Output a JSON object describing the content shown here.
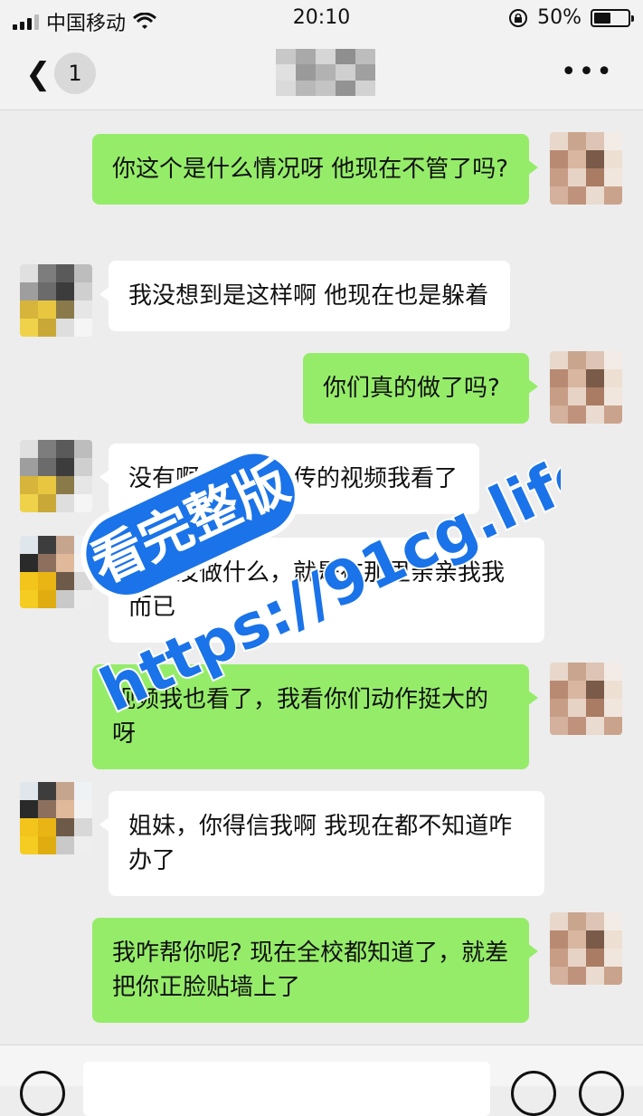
{
  "status_bar": {
    "carrier": "中国移动",
    "time": "20:10",
    "battery": "50%",
    "battery_level": 0.5,
    "icons": [
      "signal-icon",
      "wifi-icon",
      "lock-rotation-icon",
      "battery-icon"
    ]
  },
  "nav": {
    "back_icon": "chevron-left-icon",
    "unread_count": "1",
    "title_pixelated": true,
    "more_icon": "more-dots-icon"
  },
  "messages": [
    {
      "side": "me",
      "text": "你这个是什么情况呀 他现在不管了吗?"
    },
    {
      "side": "them",
      "text": "我没想到是这样啊 他现在也是躲着"
    },
    {
      "side": "me",
      "text": "你们真的做了吗?"
    },
    {
      "side": "them",
      "text": "没有啊，学校里传的视频我看了"
    },
    {
      "side": "them",
      "text": "我们没做什么，就是在那里亲亲我我而已"
    },
    {
      "side": "me",
      "text": "视频我也看了，我看你们动作挺大的呀"
    },
    {
      "side": "them",
      "text": "姐妹，你得信我啊 我现在都不知道咋办了"
    },
    {
      "side": "me",
      "text": "我咋帮你呢? 现在全校都知道了，就差把你正脸贴墙上了"
    }
  ],
  "watermark": {
    "badge_text": "看完整版",
    "url_text": "https://91cg.life",
    "color": "#1a73e8"
  },
  "colors": {
    "me_bubble": "#95ec69",
    "them_bubble": "#ffffff",
    "background": "#ededed"
  }
}
